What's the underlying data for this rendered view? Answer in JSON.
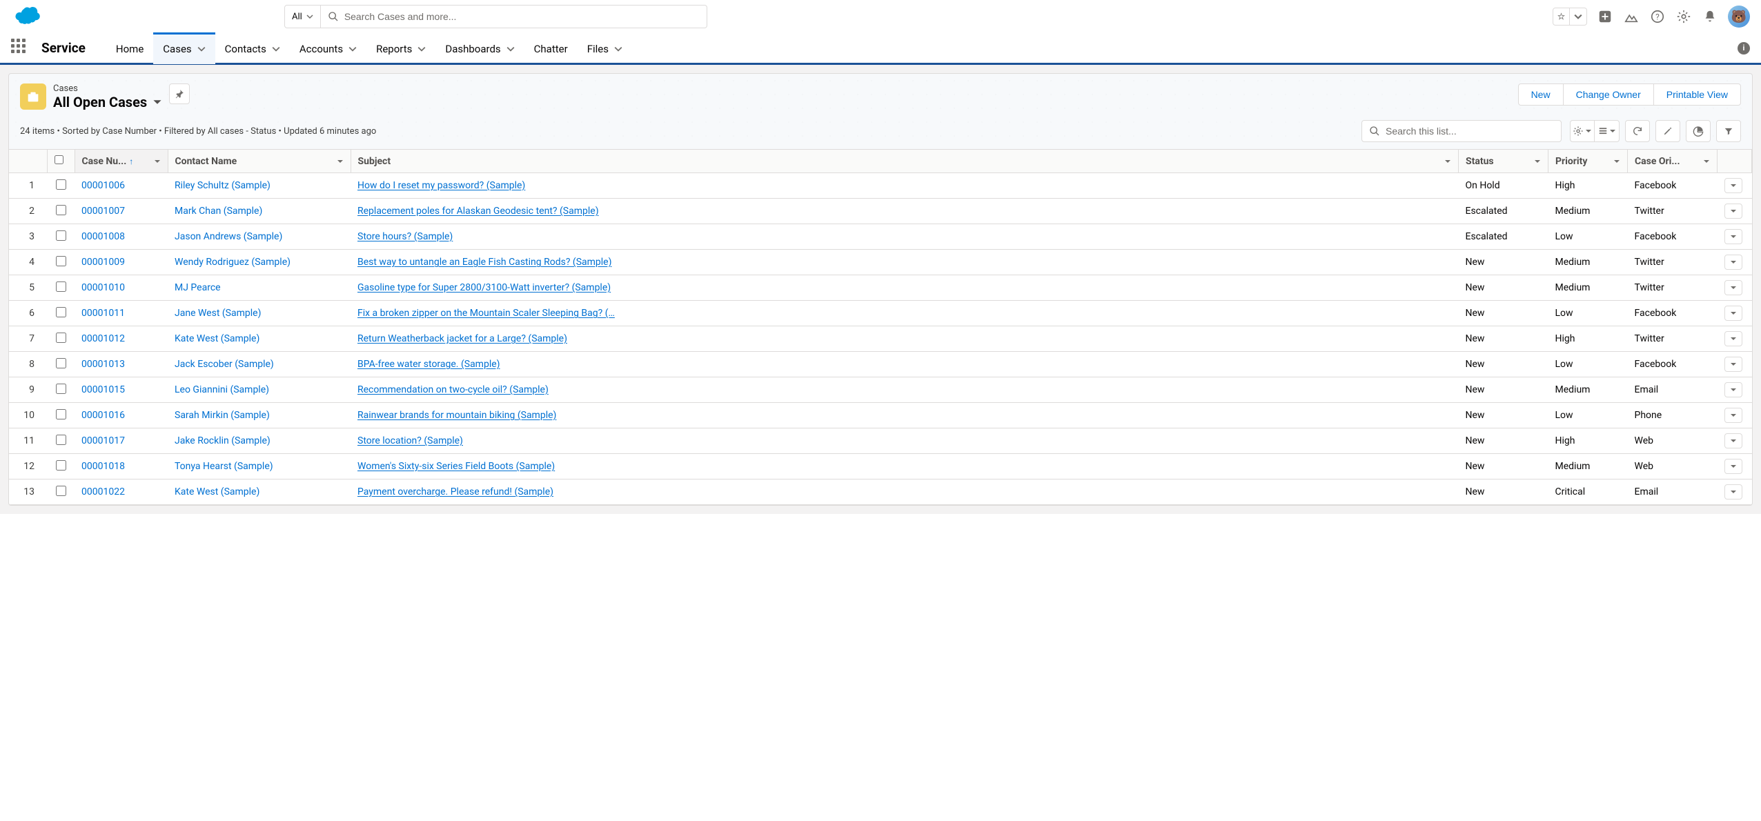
{
  "header": {
    "search_scope": "All",
    "search_placeholder": "Search Cases and more..."
  },
  "nav": {
    "app_name": "Service",
    "items": [
      {
        "label": "Home",
        "dropdown": false
      },
      {
        "label": "Cases",
        "dropdown": true,
        "active": true
      },
      {
        "label": "Contacts",
        "dropdown": true
      },
      {
        "label": "Accounts",
        "dropdown": true
      },
      {
        "label": "Reports",
        "dropdown": true
      },
      {
        "label": "Dashboards",
        "dropdown": true
      },
      {
        "label": "Chatter",
        "dropdown": false
      },
      {
        "label": "Files",
        "dropdown": true
      }
    ]
  },
  "page": {
    "object_label": "Cases",
    "view_name": "All Open Cases",
    "meta": "24 items • Sorted by Case Number • Filtered by All cases - Status • Updated 6 minutes ago",
    "list_search_placeholder": "Search this list...",
    "actions": {
      "new": "New",
      "change_owner": "Change Owner",
      "printable": "Printable View"
    }
  },
  "table": {
    "columns": {
      "case_number": "Case Nu...",
      "contact_name": "Contact Name",
      "subject": "Subject",
      "status": "Status",
      "priority": "Priority",
      "case_origin": "Case Ori..."
    },
    "rows": [
      {
        "n": "1",
        "case": "00001006",
        "contact": "Riley Schultz (Sample)",
        "subject": "How do I reset my password? (Sample)",
        "status": "On Hold",
        "priority": "High",
        "origin": "Facebook"
      },
      {
        "n": "2",
        "case": "00001007",
        "contact": "Mark Chan (Sample)",
        "subject": "Replacement poles for Alaskan Geodesic tent? (Sample)",
        "status": "Escalated",
        "priority": "Medium",
        "origin": "Twitter"
      },
      {
        "n": "3",
        "case": "00001008",
        "contact": "Jason Andrews (Sample)",
        "subject": "Store hours? (Sample)",
        "status": "Escalated",
        "priority": "Low",
        "origin": "Facebook"
      },
      {
        "n": "4",
        "case": "00001009",
        "contact": "Wendy Rodriguez (Sample)",
        "subject": "Best way to untangle an Eagle Fish Casting Rods? (Sample)",
        "status": "New",
        "priority": "Medium",
        "origin": "Twitter"
      },
      {
        "n": "5",
        "case": "00001010",
        "contact": "MJ Pearce",
        "subject": "Gasoline type for Super 2800/3100-Watt inverter? (Sample)",
        "status": "New",
        "priority": "Medium",
        "origin": "Twitter"
      },
      {
        "n": "6",
        "case": "00001011",
        "contact": "Jane West (Sample)",
        "subject": "Fix a broken zipper on the Mountain Scaler Sleeping Bag? (…",
        "status": "New",
        "priority": "Low",
        "origin": "Facebook"
      },
      {
        "n": "7",
        "case": "00001012",
        "contact": "Kate West (Sample)",
        "subject": "Return Weatherback jacket for a Large? (Sample)",
        "status": "New",
        "priority": "High",
        "origin": "Twitter"
      },
      {
        "n": "8",
        "case": "00001013",
        "contact": "Jack Escober (Sample)",
        "subject": "BPA-free water storage. (Sample)",
        "status": "New",
        "priority": "Low",
        "origin": "Facebook"
      },
      {
        "n": "9",
        "case": "00001015",
        "contact": "Leo Giannini (Sample)",
        "subject": "Recommendation on two-cycle oil? (Sample)",
        "status": "New",
        "priority": "Medium",
        "origin": "Email"
      },
      {
        "n": "10",
        "case": "00001016",
        "contact": "Sarah Mirkin (Sample)",
        "subject": "Rainwear brands for mountain biking (Sample)",
        "status": "New",
        "priority": "Low",
        "origin": "Phone"
      },
      {
        "n": "11",
        "case": "00001017",
        "contact": "Jake Rocklin (Sample)",
        "subject": "Store location? (Sample)",
        "status": "New",
        "priority": "High",
        "origin": "Web"
      },
      {
        "n": "12",
        "case": "00001018",
        "contact": "Tonya Hearst (Sample)",
        "subject": "Women's Sixty-six Series Field Boots (Sample)",
        "status": "New",
        "priority": "Medium",
        "origin": "Web"
      },
      {
        "n": "13",
        "case": "00001022",
        "contact": "Kate West (Sample)",
        "subject": "Payment overcharge. Please refund! (Sample)",
        "status": "New",
        "priority": "Critical",
        "origin": "Email"
      }
    ]
  }
}
